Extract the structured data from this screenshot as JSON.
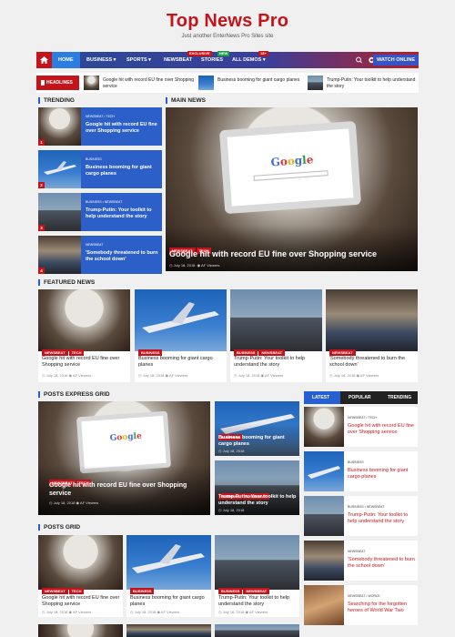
{
  "site": {
    "title": "Top News Pro",
    "tagline": "Just another EnterNews Pro Sites site"
  },
  "nav": {
    "items": [
      "HOME",
      "BUSINESS ▾",
      "SPORTS ▾",
      "NEWSBEAT",
      "STORIES",
      "ALL DEMOS ▾"
    ],
    "badges": {
      "stories_top": "EXCLUSIVE",
      "stories": "NEW",
      "demos": "18+"
    },
    "watch": "WATCH ONLINE"
  },
  "ticker": {
    "label": "HEADLINES",
    "items": [
      "Google hit with record EU fine over Shopping service",
      "Business booming for giant cargo planes",
      "Trump-Putin: Your toolkit to help understand the story"
    ]
  },
  "sections": {
    "trending": "TRENDING",
    "main": "MAIN NEWS",
    "featured": "FEATURED NEWS",
    "express": "POSTS EXPRESS GRID",
    "grid": "POSTS GRID"
  },
  "tabs": [
    "LATEST",
    "POPULAR",
    "TRENDING"
  ],
  "trending": [
    {
      "n": "1",
      "cats": "NEWSBEAT • TECH",
      "title": "Google hit with record EU fine over Shopping service"
    },
    {
      "n": "2",
      "cats": "BUSINESS",
      "title": "Business booming for giant cargo planes"
    },
    {
      "n": "3",
      "cats": "BUSINESS • NEWSBEAT",
      "title": "Trump-Putin: Your toolkit to help understand the story"
    },
    {
      "n": "4",
      "cats": "NEWSBEAT",
      "title": "'Somebody threatened to burn the school down'"
    }
  ],
  "main": {
    "tags": [
      "NEWSBEAT",
      "TECH"
    ],
    "title": "Google hit with record EU fine over Shopping service",
    "date": "July 18, 2018",
    "views": "AF Viewers"
  },
  "featured": [
    {
      "tags": [
        "NEWSBEAT",
        "TECH"
      ],
      "title": "Google hit with record EU fine over Shopping service",
      "date": "July 18, 2018",
      "views": "AF Viewers"
    },
    {
      "tags": [
        "BUSINESS"
      ],
      "title": "Business booming for giant cargo planes",
      "date": "July 18, 2018",
      "views": "AF Viewers"
    },
    {
      "tags": [
        "BUSINESS",
        "NEWSBEAT"
      ],
      "title": "Trump-Putin: Your toolkit to help understand the story",
      "date": "July 18, 2018",
      "views": "AF Viewers"
    },
    {
      "tags": [
        "NEWSBEAT"
      ],
      "title": "'Somebody threatened to burn the school down'",
      "date": "July 18, 2018",
      "views": "AF Viewers"
    }
  ],
  "express": {
    "big": {
      "tags": [
        "NEWSBEAT",
        "TECH"
      ],
      "title": "Google hit with record EU fine over Shopping service",
      "date": "July 18, 2018",
      "views": "AF Viewers"
    },
    "small": [
      {
        "tags": [
          "BUSINESS"
        ],
        "title": "Business booming for giant cargo planes",
        "date": "July 18, 2018"
      },
      {
        "tags": [
          "BUSINESS",
          "NEWSBEAT"
        ],
        "title": "Trump-Putin: Your toolkit to help understand the story",
        "date": "July 18, 2018"
      }
    ]
  },
  "grid": [
    {
      "tags": [
        "NEWSBEAT",
        "TECH"
      ],
      "title": "Google hit with record EU fine over Shopping service",
      "date": "July 18, 2018",
      "views": "AF Viewers"
    },
    {
      "tags": [
        "BUSINESS"
      ],
      "title": "Business booming for giant cargo planes",
      "date": "July 18, 2018",
      "views": "AF Viewers"
    },
    {
      "tags": [
        "BUSINESS",
        "NEWSBEAT"
      ],
      "title": "Trump-Putin: Your toolkit to help understand the story",
      "date": "July 18, 2018",
      "views": "AF Viewers"
    }
  ],
  "sidebar": [
    {
      "cats": "NEWSBEAT • TECH",
      "title": "Google hit with record EU fine over Shopping service"
    },
    {
      "cats": "BUSINESS",
      "title": "Business booming for giant cargo planes"
    },
    {
      "cats": "BUSINESS • NEWSBEAT",
      "title": "Trump-Putin: Your toolkit to help understand the story"
    },
    {
      "cats": "NEWSBEAT",
      "title": "'Somebody threatened to burn the school down'"
    },
    {
      "cats": "NEWSBEAT • WORLD",
      "title": "Searching for the forgotten heroes of World War Two"
    }
  ],
  "colors": {
    "brand": "#c4141b",
    "accent": "#2660d0"
  }
}
